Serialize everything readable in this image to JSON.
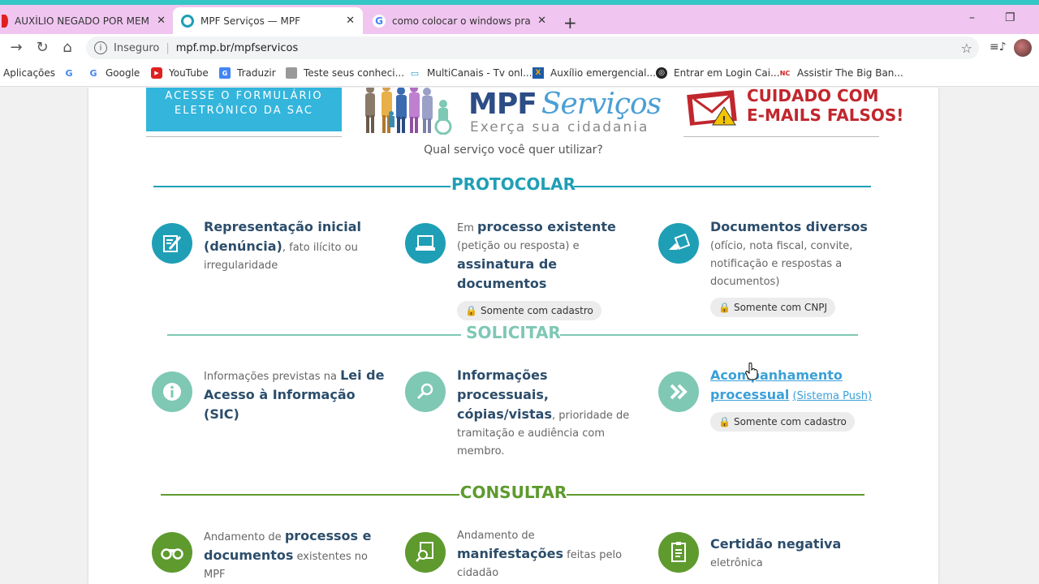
{
  "browser": {
    "tabs": [
      {
        "title": "AUXÍLIO NEGADO POR MEMBRO",
        "favicon_color": "#e02020"
      },
      {
        "title": "MPF Serviços — MPF",
        "favicon_color": "#1f9fb6"
      },
      {
        "title": "como colocar o windows pra gra",
        "favicon_color": "#4285f4"
      }
    ],
    "new_tab": "+",
    "window_controls": {
      "minimize": "–",
      "restore": "❐"
    },
    "omnibox": {
      "security_label": "Inseguro",
      "url": "mpf.mp.br/mpfservicos"
    },
    "bookmarks": [
      {
        "label": "Aplicações",
        "icon": "apps-icon"
      },
      {
        "label": "Google",
        "icon": "google-icon"
      },
      {
        "label": "YouTube",
        "icon": "youtube-icon"
      },
      {
        "label": "Traduzir",
        "icon": "translate-icon"
      },
      {
        "label": "Teste seus conheci...",
        "icon": "page-icon"
      },
      {
        "label": "MultiCanais - Tv onl...",
        "icon": "tv-icon"
      },
      {
        "label": "Auxílio emergencial...",
        "icon": "caixa-icon"
      },
      {
        "label": "Entrar em Login Cai...",
        "icon": "globe-icon"
      },
      {
        "label": "Assistir The Big Ban...",
        "icon": "nc-icon"
      }
    ]
  },
  "page": {
    "sac_button": {
      "line1": "ACESSE O FORMULÁRIO",
      "line2": "ELETRÔNICO DA SAC"
    },
    "logo": {
      "mpf": "MPF",
      "servicos": "Serviços",
      "tagline": "Exerça sua cidadania"
    },
    "warning": {
      "line1": "CUIDADO COM",
      "line2": "E-MAILS FALSOS!"
    },
    "question": "Qual serviço você quer utilizar?",
    "sections": {
      "protocolar": "PROTOCOLAR",
      "solicitar": "SOLICITAR",
      "consultar": "CONSULTAR"
    },
    "protocolar_items": [
      {
        "bold": "Representação inicial (denúncia)",
        "rest": ", fato ilícito ou irregularidade"
      },
      {
        "pre": "Em ",
        "bold": "processo existente",
        "mid": " (petição ou resposta) e ",
        "bold2": "assinatura de documentos",
        "badge": "Somente com cadastro"
      },
      {
        "bold": "Documentos diversos",
        "rest": " (ofício, nota fiscal, convite, notificação e respostas a documentos)",
        "badge": "Somente com CNPJ"
      }
    ],
    "solicitar_items": [
      {
        "pre": "Informações previstas na ",
        "bold": "Lei de Acesso à Informação (SIC)"
      },
      {
        "bold": "Informações processuais, cópias/vistas",
        "rest": ", prioridade de tramitação e audiência com membro."
      },
      {
        "link": "Acompanhamento processual",
        "link_small": "(Sistema Push)",
        "badge": "Somente com cadastro"
      }
    ],
    "consultar_items": [
      {
        "pre": "Andamento de ",
        "bold": "processos e documentos",
        "rest": " existentes no MPF"
      },
      {
        "pre": "Andamento de ",
        "bold": "manifestações",
        "rest": " feitas pelo cidadão"
      },
      {
        "bold": "Certidão negativa",
        "rest": " eletrônica"
      }
    ],
    "colors": {
      "protocolar": "#1f9fb6",
      "solicitar": "#7ec8b4",
      "consultar": "#5e9a2e",
      "heading_text": "#2c4d6b"
    }
  }
}
